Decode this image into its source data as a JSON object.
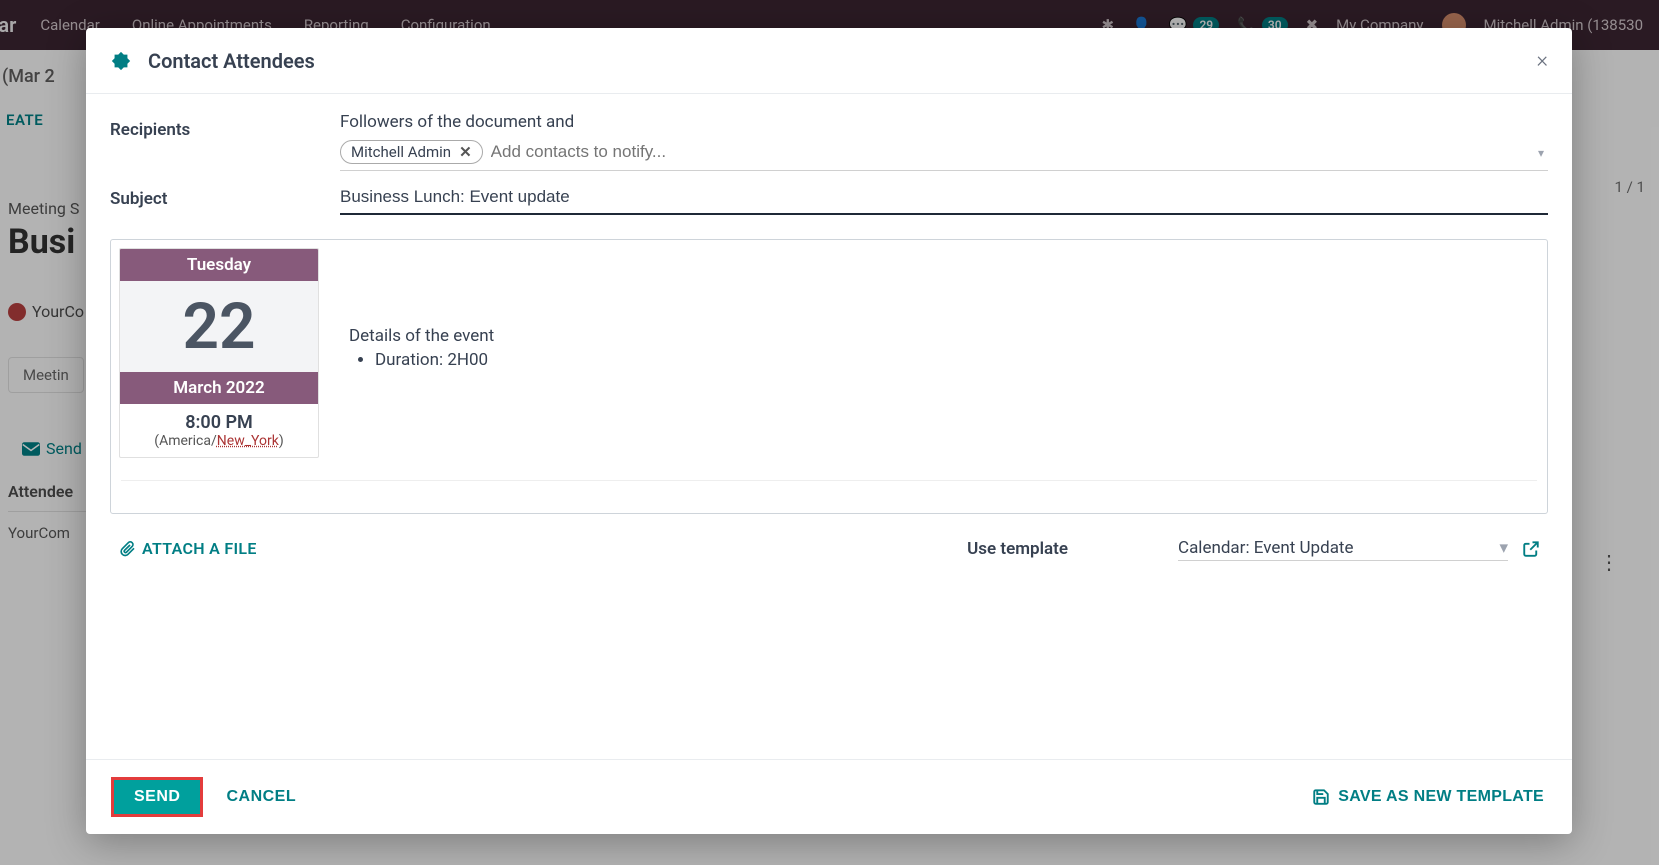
{
  "background": {
    "app_name": "ndar",
    "nav": [
      "Calendar",
      "Online Appointments",
      "Reporting",
      "Configuration"
    ],
    "badges": {
      "msg": "29",
      "call": "30"
    },
    "company": "My Company",
    "user": "Mitchell Admin (138530",
    "breadcrumb": "(Mar 2",
    "create": "EATE",
    "pager": "1 / 1",
    "meeting_subj_label": "Meeting S",
    "title": "Busi",
    "yourco": "YourCo",
    "tab": "Meetin",
    "send": "Send",
    "att_head": "Attendee",
    "att_row": "YourCom"
  },
  "modal": {
    "title": "Contact Attendees",
    "labels": {
      "recipients": "Recipients",
      "subject": "Subject",
      "followers": "Followers of the document and",
      "add_contacts_placeholder": "Add contacts to notify...",
      "use_template": "Use template",
      "attach": "ATTACH A FILE",
      "send": "SEND",
      "cancel": "CANCEL",
      "save_tpl": "SAVE AS NEW TEMPLATE"
    },
    "recipient_tag": "Mitchell Admin",
    "subject_value": "Business Lunch: Event update",
    "event": {
      "dow": "Tuesday",
      "daynum": "22",
      "monthyear": "March 2022",
      "time": "8:00 PM",
      "tz_prefix": "(America/",
      "tz_link": "New_York",
      "tz_suffix": ")",
      "details_title": "Details of the event",
      "duration": "Duration: 2H00"
    },
    "template_selected": "Calendar: Event Update"
  }
}
